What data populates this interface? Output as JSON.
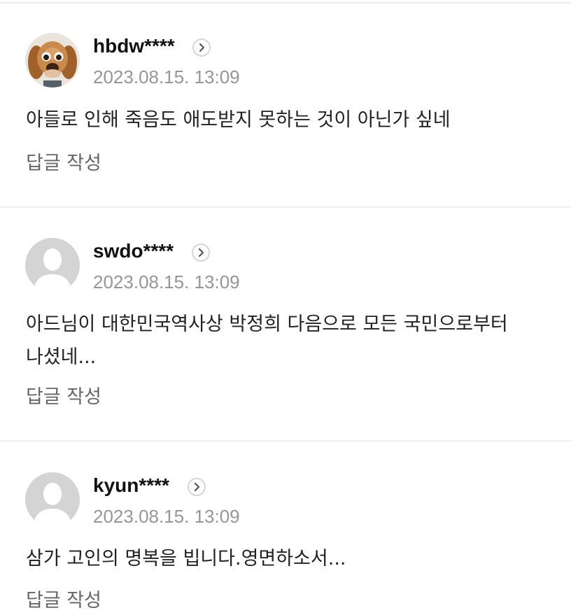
{
  "comments": [
    {
      "avatar_icon": "dog-photo-avatar",
      "username": "hbdw****",
      "timestamp": "2023.08.15. 13:09",
      "text": "아들로 인해 죽음도 애도받지 못하는 것이 아닌가 싶네",
      "reply_label": "답글 작성"
    },
    {
      "avatar_icon": "default-user-avatar",
      "username": "swdo****",
      "timestamp": "2023.08.15. 13:09",
      "text": "아드님이 대한민국역사상 박정희 다음으로 모든 국민으로부터 나셨네...",
      "reply_label": "답글 작성"
    },
    {
      "avatar_icon": "default-user-avatar",
      "username": "kyun****",
      "timestamp": "2023.08.15. 13:09",
      "text": "삼가 고인의 명복을 빕니다.영면하소서...",
      "reply_label": "답글 작성"
    }
  ],
  "more_icon": "chevron-right-circle-icon",
  "colors": {
    "divider": "#efefef",
    "timestamp": "#969696",
    "reply": "#666666",
    "avatar_default_bg": "#d4d4d4"
  }
}
